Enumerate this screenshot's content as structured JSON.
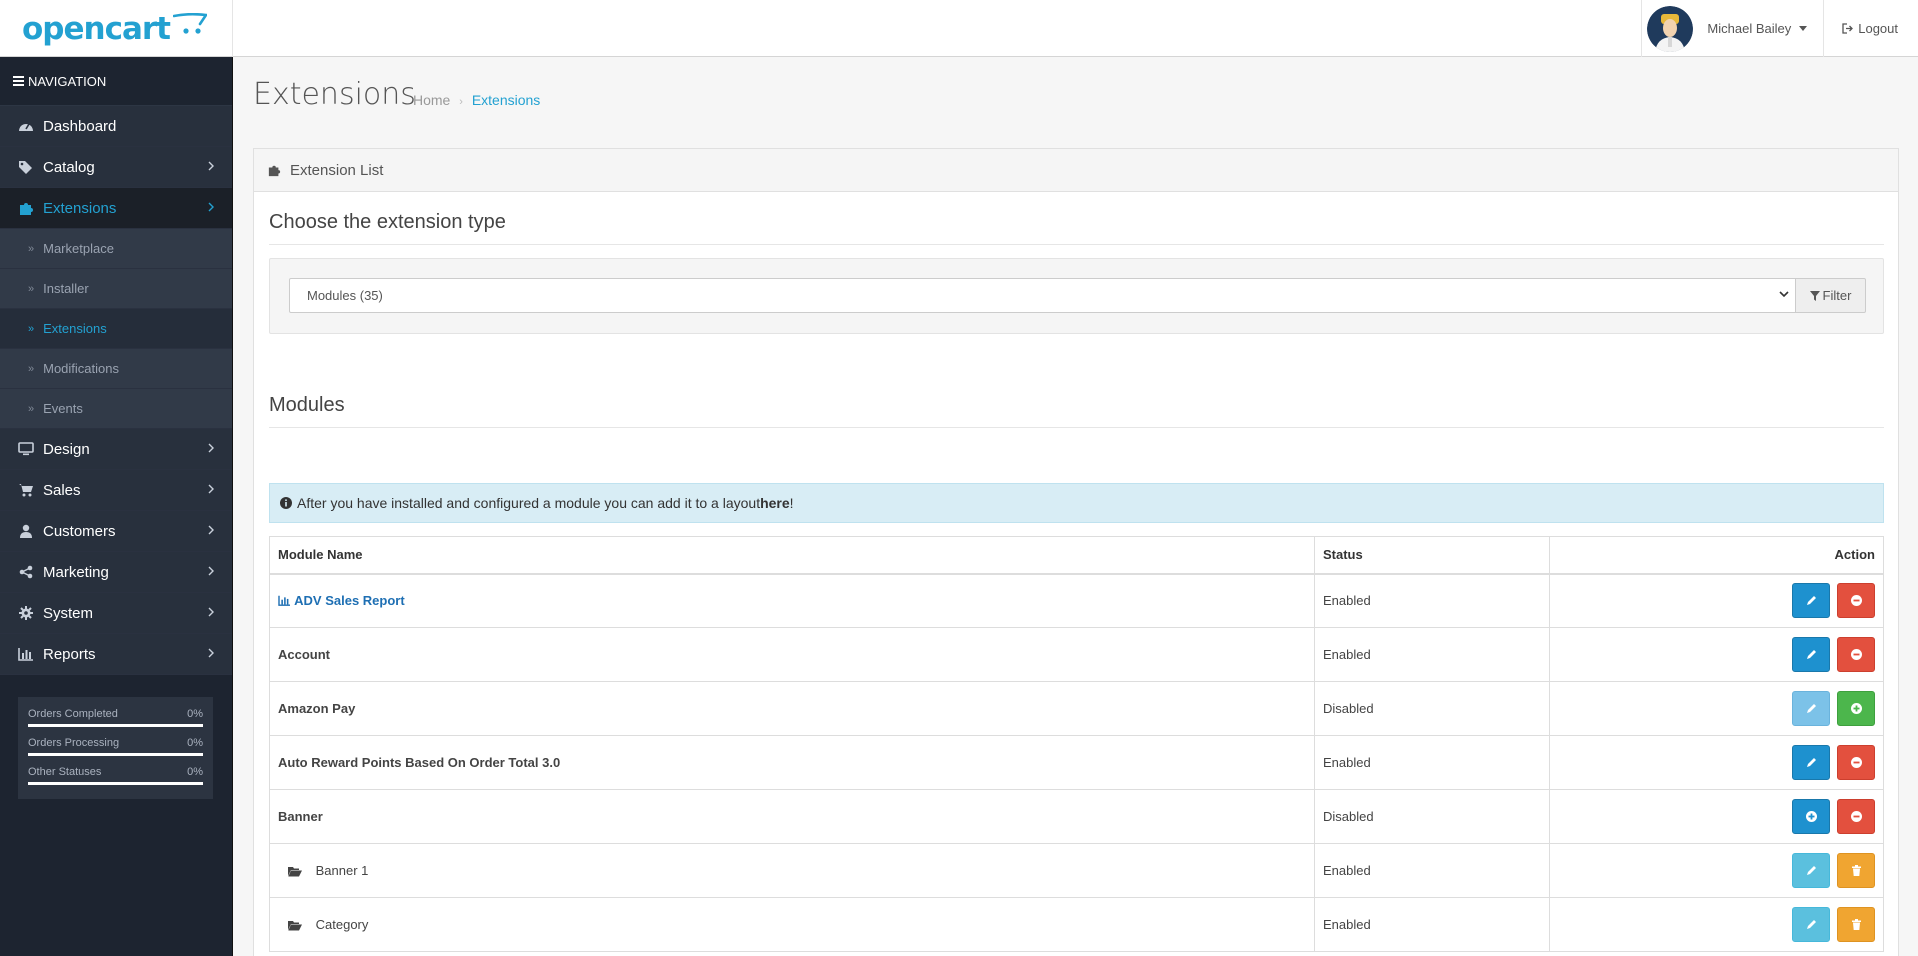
{
  "header": {
    "logo_text": "opencart",
    "user_name": "Michael Bailey",
    "logout_label": "Logout"
  },
  "sidebar": {
    "nav_title": "NAVIGATION",
    "items": [
      {
        "label": "Dashboard",
        "icon": "dashboard-icon"
      },
      {
        "label": "Catalog",
        "icon": "tags-icon"
      },
      {
        "label": "Extensions",
        "icon": "puzzle-icon",
        "active": true
      },
      {
        "label": "Design",
        "icon": "monitor-icon"
      },
      {
        "label": "Sales",
        "icon": "cart-icon"
      },
      {
        "label": "Customers",
        "icon": "user-icon"
      },
      {
        "label": "Marketing",
        "icon": "share-icon"
      },
      {
        "label": "System",
        "icon": "gear-icon"
      },
      {
        "label": "Reports",
        "icon": "bar-chart-icon"
      }
    ],
    "sub_items": [
      {
        "label": "Marketplace"
      },
      {
        "label": "Installer"
      },
      {
        "label": "Extensions",
        "active": true
      },
      {
        "label": "Modifications"
      },
      {
        "label": "Events"
      }
    ],
    "stats": [
      {
        "label": "Orders Completed",
        "value": "0%"
      },
      {
        "label": "Orders Processing",
        "value": "0%"
      },
      {
        "label": "Other Statuses",
        "value": "0%"
      }
    ]
  },
  "page": {
    "title": "Extensions",
    "breadcrumb": [
      "Home",
      "Extensions"
    ],
    "panel_title": "Extension List",
    "choose_title": "Choose the extension type",
    "select_value": "Modules (35)",
    "filter_label": "Filter",
    "modules_title": "Modules",
    "alert_text": "After you have installed and configured a module you can add it to a layout ",
    "alert_link": "here",
    "alert_end": "!"
  },
  "table": {
    "headers": [
      "Module Name",
      "Status",
      "Action"
    ],
    "rows": [
      {
        "name": "ADV Sales Report",
        "status": "Enabled"
      },
      {
        "name": "Account",
        "status": "Enabled"
      },
      {
        "name": "Amazon Pay",
        "status": "Disabled"
      },
      {
        "name": "Auto Reward Points Based On Order Total 3.0",
        "status": "Enabled"
      },
      {
        "name": "Banner",
        "status": "Disabled"
      },
      {
        "name": "Banner 1",
        "status": "Enabled"
      },
      {
        "name": "Category",
        "status": "Enabled"
      }
    ]
  },
  "colors": {
    "accent": "#23a1d1",
    "sidebar_bg": "#1d2430",
    "btn_blue": "#1e91cf",
    "btn_red": "#e3503e",
    "btn_green": "#4cb64c",
    "btn_info": "#5bc0de",
    "btn_orange": "#f0a531"
  }
}
